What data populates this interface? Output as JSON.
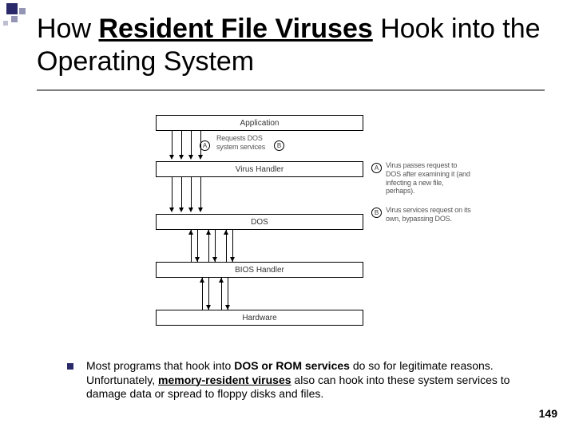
{
  "title": {
    "pre": "How ",
    "bold_u": "Resident File Viruses",
    "mid": " Hook into the Operating System"
  },
  "diagram": {
    "boxes": {
      "app": "Application",
      "virus": "Virus Handler",
      "dos": "DOS",
      "bios": "BIOS Handler",
      "hw": "Hardware"
    },
    "req_text": "Requests DOS system services",
    "markers": {
      "a": "A",
      "b": "B"
    },
    "note_a": "Virus passes request to DOS after examining it (and infecting a new file, perhaps).",
    "note_b": "Virus services request on its own, bypassing DOS."
  },
  "bullet": {
    "p1": "Most programs that hook into ",
    "b1": "DOS or ROM services",
    "p2": " do so for legitimate reasons. Unfortunately, ",
    "b2": "memory-resident viruses",
    "p3": " also can hook into these system services to damage data or spread to floppy disks and files."
  },
  "pagenum": "149"
}
